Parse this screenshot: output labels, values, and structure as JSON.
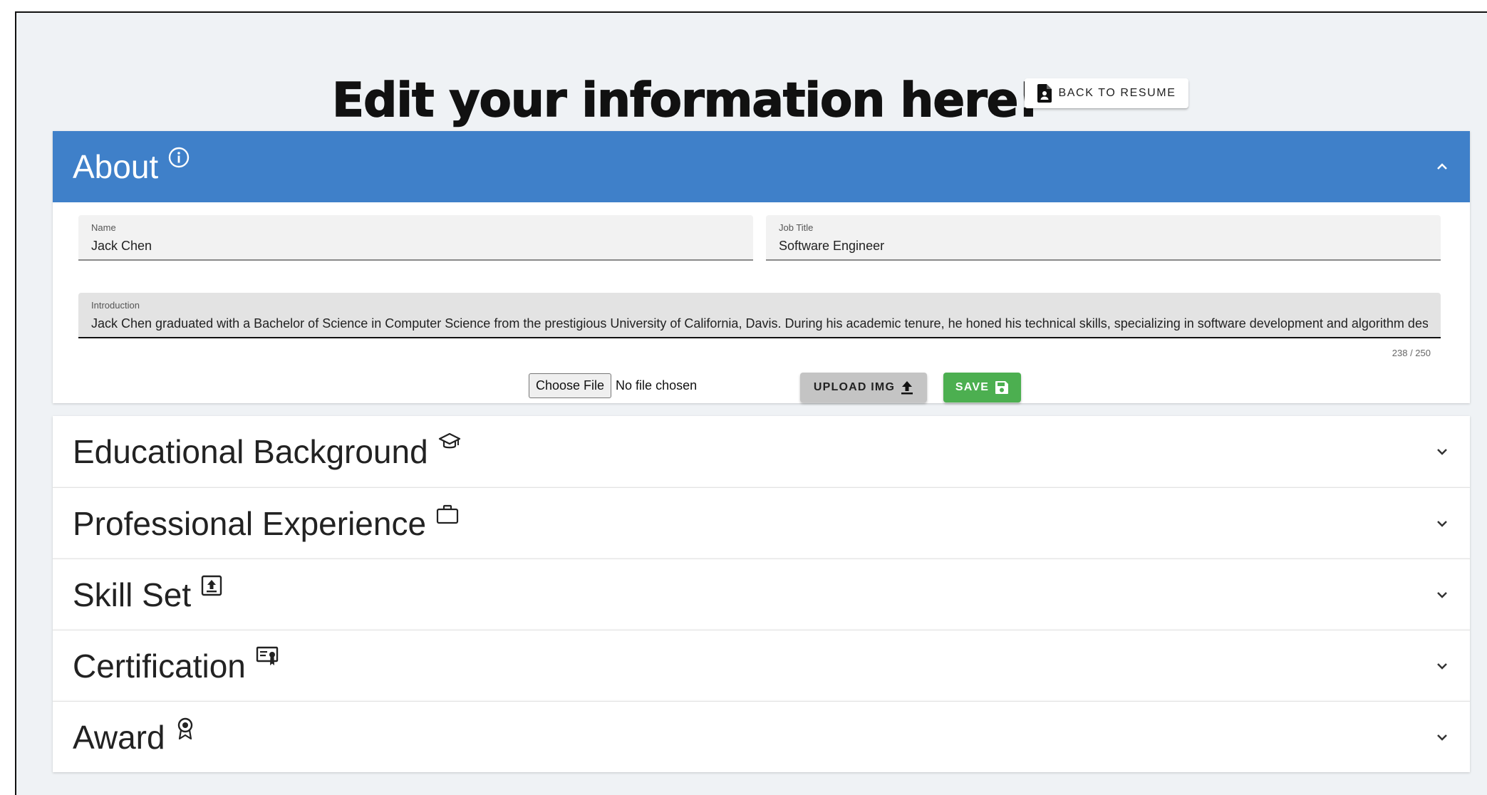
{
  "header": {
    "title": "Edit your information here!",
    "back_button_label": "BACK TO RESUME",
    "back_button_icon": "file-person-icon"
  },
  "about": {
    "title": "About",
    "icon": "info-circle-icon",
    "expanded": true,
    "accent_color": "#3f80c9",
    "fields": {
      "name": {
        "label": "Name",
        "value": "Jack Chen"
      },
      "job_title": {
        "label": "Job Title",
        "value": "Software Engineer"
      },
      "introduction": {
        "label": "Introduction",
        "value": "Jack Chen graduated with a Bachelor of Science in Computer Science from the prestigious University of California, Davis. During his academic tenure, he honed his technical skills, specializing in software development and algorithm des",
        "counter": "238 / 250"
      }
    },
    "file_input": {
      "button_label": "Choose File",
      "status": "No file chosen"
    },
    "upload_button_label": "UPLOAD IMG",
    "save_button_label": "SAVE",
    "save_color": "#4caf50"
  },
  "sections": [
    {
      "title": "Educational Background",
      "icon": "graduation-cap-icon",
      "expanded": false
    },
    {
      "title": "Professional Experience",
      "icon": "briefcase-icon",
      "expanded": false
    },
    {
      "title": "Skill Set",
      "icon": "upload-square-icon",
      "expanded": false
    },
    {
      "title": "Certification",
      "icon": "certificate-icon",
      "expanded": false
    },
    {
      "title": "Award",
      "icon": "award-ribbon-icon",
      "expanded": false
    }
  ]
}
